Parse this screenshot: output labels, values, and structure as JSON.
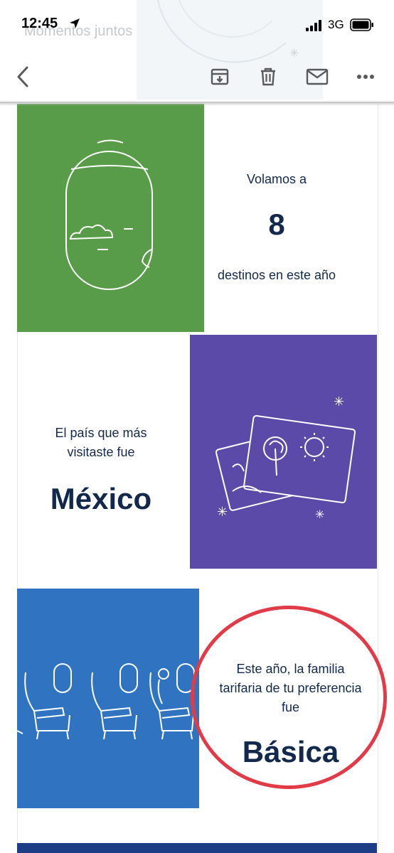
{
  "status_bar": {
    "time": "12:45",
    "network": "3G",
    "icons": [
      "location-arrow-icon",
      "signal-bars-icon",
      "battery-icon"
    ]
  },
  "header": {
    "ghost_text": "Momentos juntos"
  },
  "toolbar": {
    "icons": [
      "back-arrow-icon",
      "archive-icon",
      "trash-icon",
      "mail-icon",
      "more-icon"
    ]
  },
  "sections": {
    "destinations": {
      "intro": "Volamos a",
      "count": "8",
      "outro": "destinos en este año",
      "tile_color": "#589b48"
    },
    "country": {
      "intro_line1": "El país que más",
      "intro_line2": "visitaste fue",
      "country": "México",
      "tile_color": "#5c4aa9"
    },
    "fare": {
      "intro_line1": "Este año, la familia",
      "intro_line2": "tarifaria de tu preferencia",
      "intro_line3": "fue",
      "fare_family": "Básica",
      "tile_color": "#3073c0",
      "highlight_color": "#e03b46"
    }
  },
  "colors": {
    "text": "#13294b",
    "bottom_band": "#1d3d87"
  }
}
